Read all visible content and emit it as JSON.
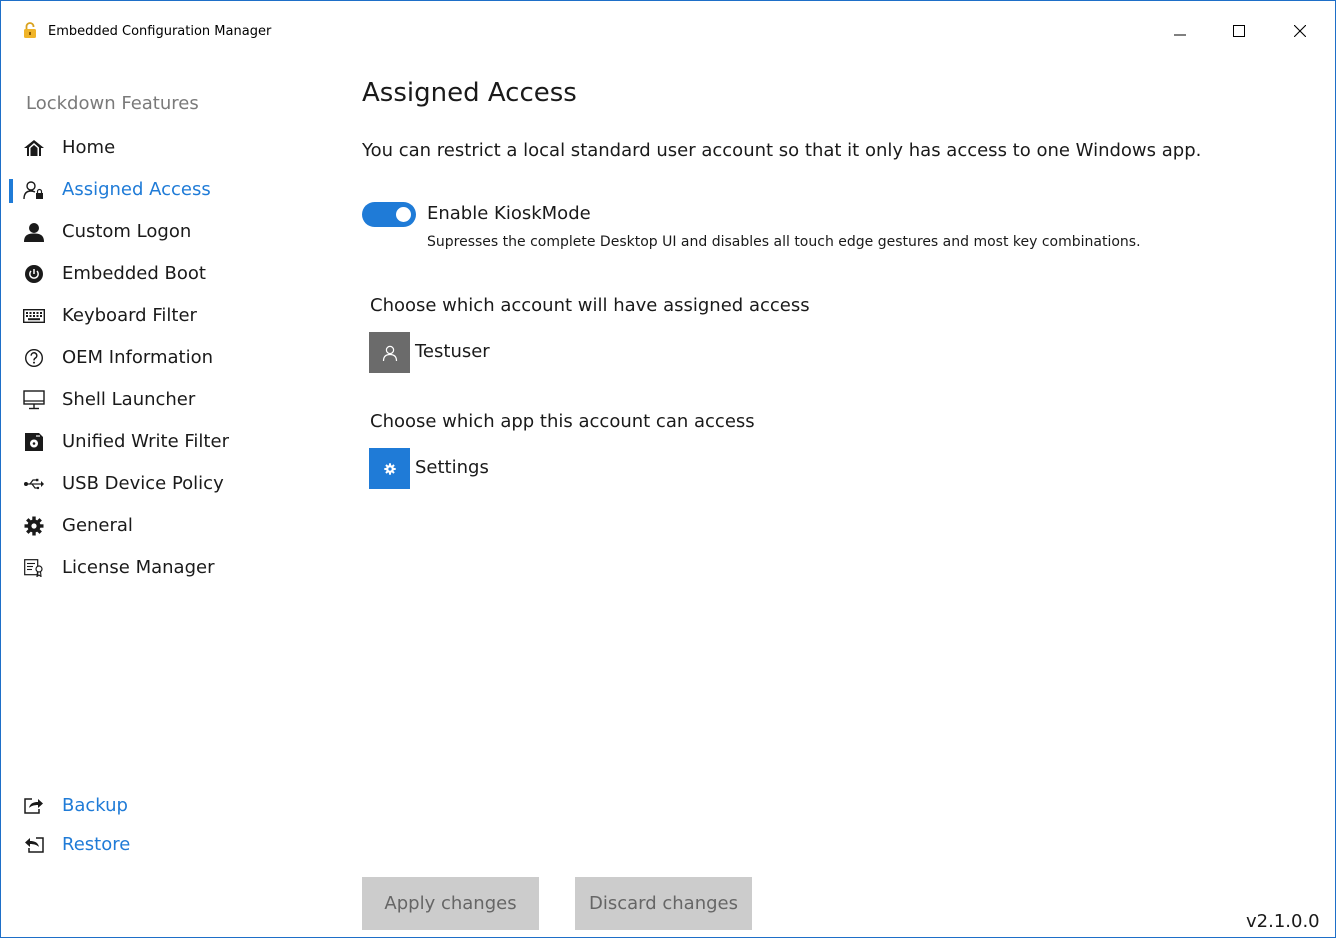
{
  "window": {
    "title": "Embedded Configuration Manager",
    "accent": "#1f7bd7",
    "border": "#1e6fc8",
    "controls": [
      "minimize-icon",
      "maximize-icon",
      "close-icon"
    ]
  },
  "sidebar": {
    "heading": "Lockdown Features",
    "items": [
      {
        "label": "Home",
        "icon": "home-icon",
        "active": false
      },
      {
        "label": "Assigned Access",
        "icon": "assigned-access-icon",
        "active": true
      },
      {
        "label": "Custom Logon",
        "icon": "user-icon",
        "active": false
      },
      {
        "label": "Embedded Boot",
        "icon": "power-icon",
        "active": false
      },
      {
        "label": "Keyboard Filter",
        "icon": "keyboard-icon",
        "active": false
      },
      {
        "label": "OEM Information",
        "icon": "question-icon",
        "active": false
      },
      {
        "label": "Shell Launcher",
        "icon": "monitor-icon",
        "active": false
      },
      {
        "label": "Unified Write Filter",
        "icon": "disk-icon",
        "active": false
      },
      {
        "label": "USB Device Policy",
        "icon": "usb-icon",
        "active": false
      },
      {
        "label": "General",
        "icon": "gear-icon",
        "active": false
      },
      {
        "label": "License Manager",
        "icon": "license-icon",
        "active": false
      }
    ],
    "footer_links": [
      {
        "label": "Backup",
        "icon": "backup-icon"
      },
      {
        "label": "Restore",
        "icon": "restore-icon"
      }
    ]
  },
  "main": {
    "title": "Assigned Access",
    "description": "You can restrict a local standard user account so that it only has access to one Windows app.",
    "kiosk": {
      "label": "Enable KioskMode",
      "enabled": true,
      "description": "Supresses the complete Desktop UI and disables all touch edge gestures and most key combinations."
    },
    "account": {
      "prompt": "Choose which account will have assigned access",
      "selected": "Testuser",
      "icon": "user-outline-icon",
      "tile_color": "#6b6b6b"
    },
    "app": {
      "prompt": "Choose which app this account can access",
      "selected": "Settings",
      "icon": "settings-gear-icon",
      "tile_color": "#1f7bd7"
    }
  },
  "actions": {
    "apply": "Apply changes",
    "discard": "Discard changes"
  },
  "version": "v2.1.0.0"
}
